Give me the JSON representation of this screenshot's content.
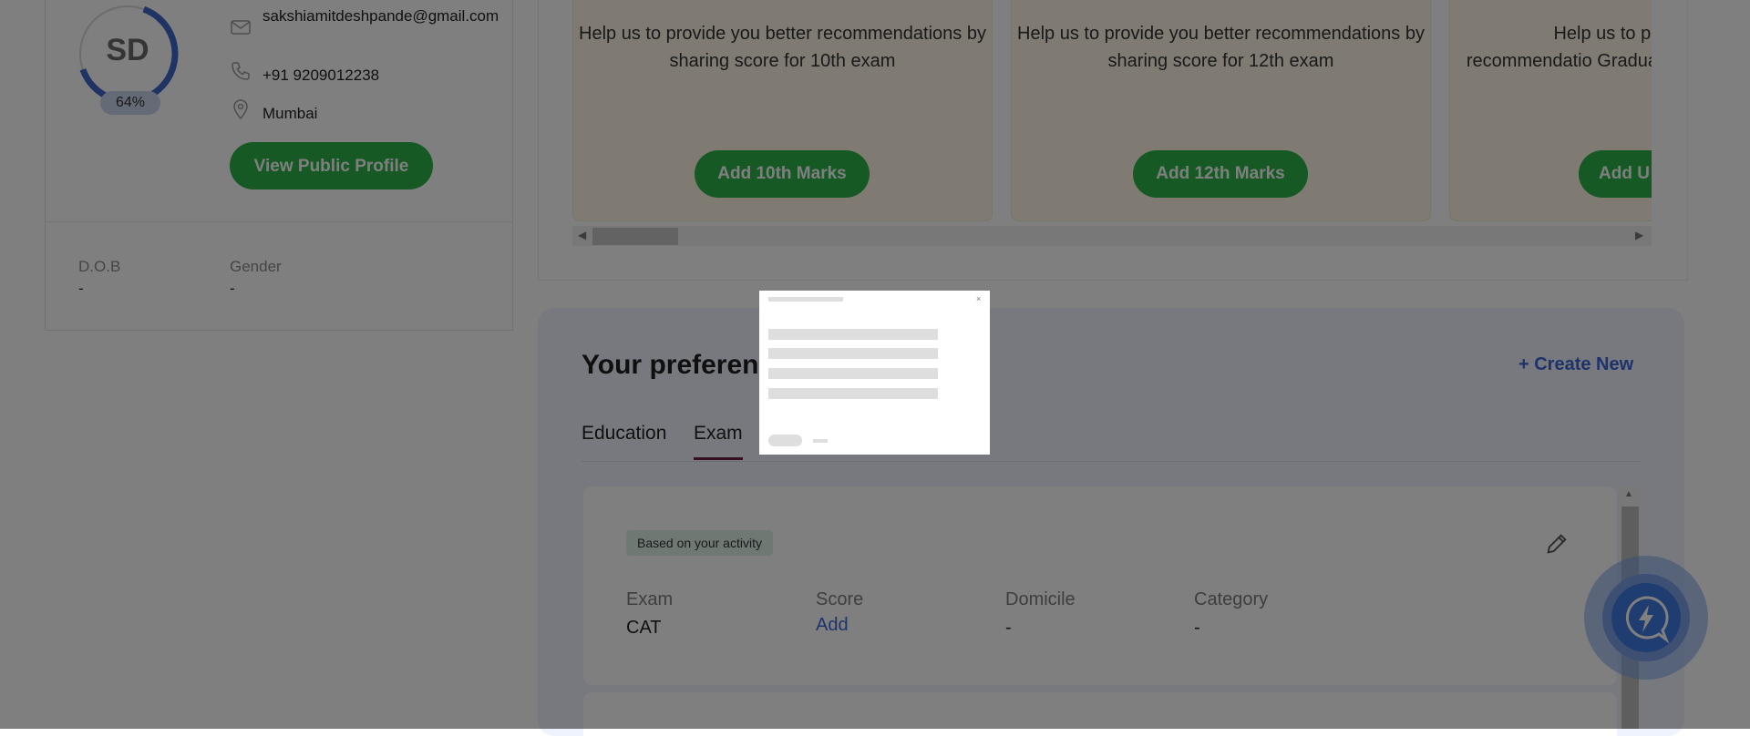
{
  "profile": {
    "initials": "SD",
    "completion": "64%",
    "completion_fraction": 0.64,
    "email": "sakshiamitdeshpande@gmail.com",
    "phone": "+91 9209012238",
    "city": "Mumbai",
    "view_profile_label": "View Public Profile",
    "dob_label": "D.O.B",
    "dob_value": "-",
    "gender_label": "Gender",
    "gender_value": "-"
  },
  "marks_cards": [
    {
      "text": "Help us to provide you better recommendations by sharing score for 10th exam",
      "button": "Add 10th Marks"
    },
    {
      "text": "Help us to provide you better recommendations by sharing score for 12th exam",
      "button": "Add 12th Marks"
    },
    {
      "text": "Help us to pro recommendatio Graduati",
      "button": "Add U"
    }
  ],
  "preferences": {
    "title": "Your preferen",
    "create_new": "+ Create New",
    "tabs": [
      "Education",
      "Exam"
    ],
    "active_tab": "Exam",
    "card": {
      "badge": "Based on your activity",
      "columns": [
        {
          "label": "Exam",
          "value": "CAT"
        },
        {
          "label": "Score",
          "value": "Add"
        },
        {
          "label": "Domicile",
          "value": "-"
        },
        {
          "label": "Category",
          "value": "-"
        }
      ]
    }
  },
  "modal": {
    "close_glyph": "×"
  },
  "colors": {
    "brand_green": "#2db34a",
    "link_blue": "#3c64d6",
    "ring_blue": "#3f66c8",
    "marks_card_bg": "#fff7e6",
    "pref_bg": "#eef3fd"
  },
  "icons": [
    "mail-icon",
    "phone-icon",
    "location-pin-icon",
    "pencil-edit-icon",
    "lightning-chat-icon",
    "scroll-left-icon",
    "scroll-right-icon",
    "scroll-up-icon"
  ]
}
